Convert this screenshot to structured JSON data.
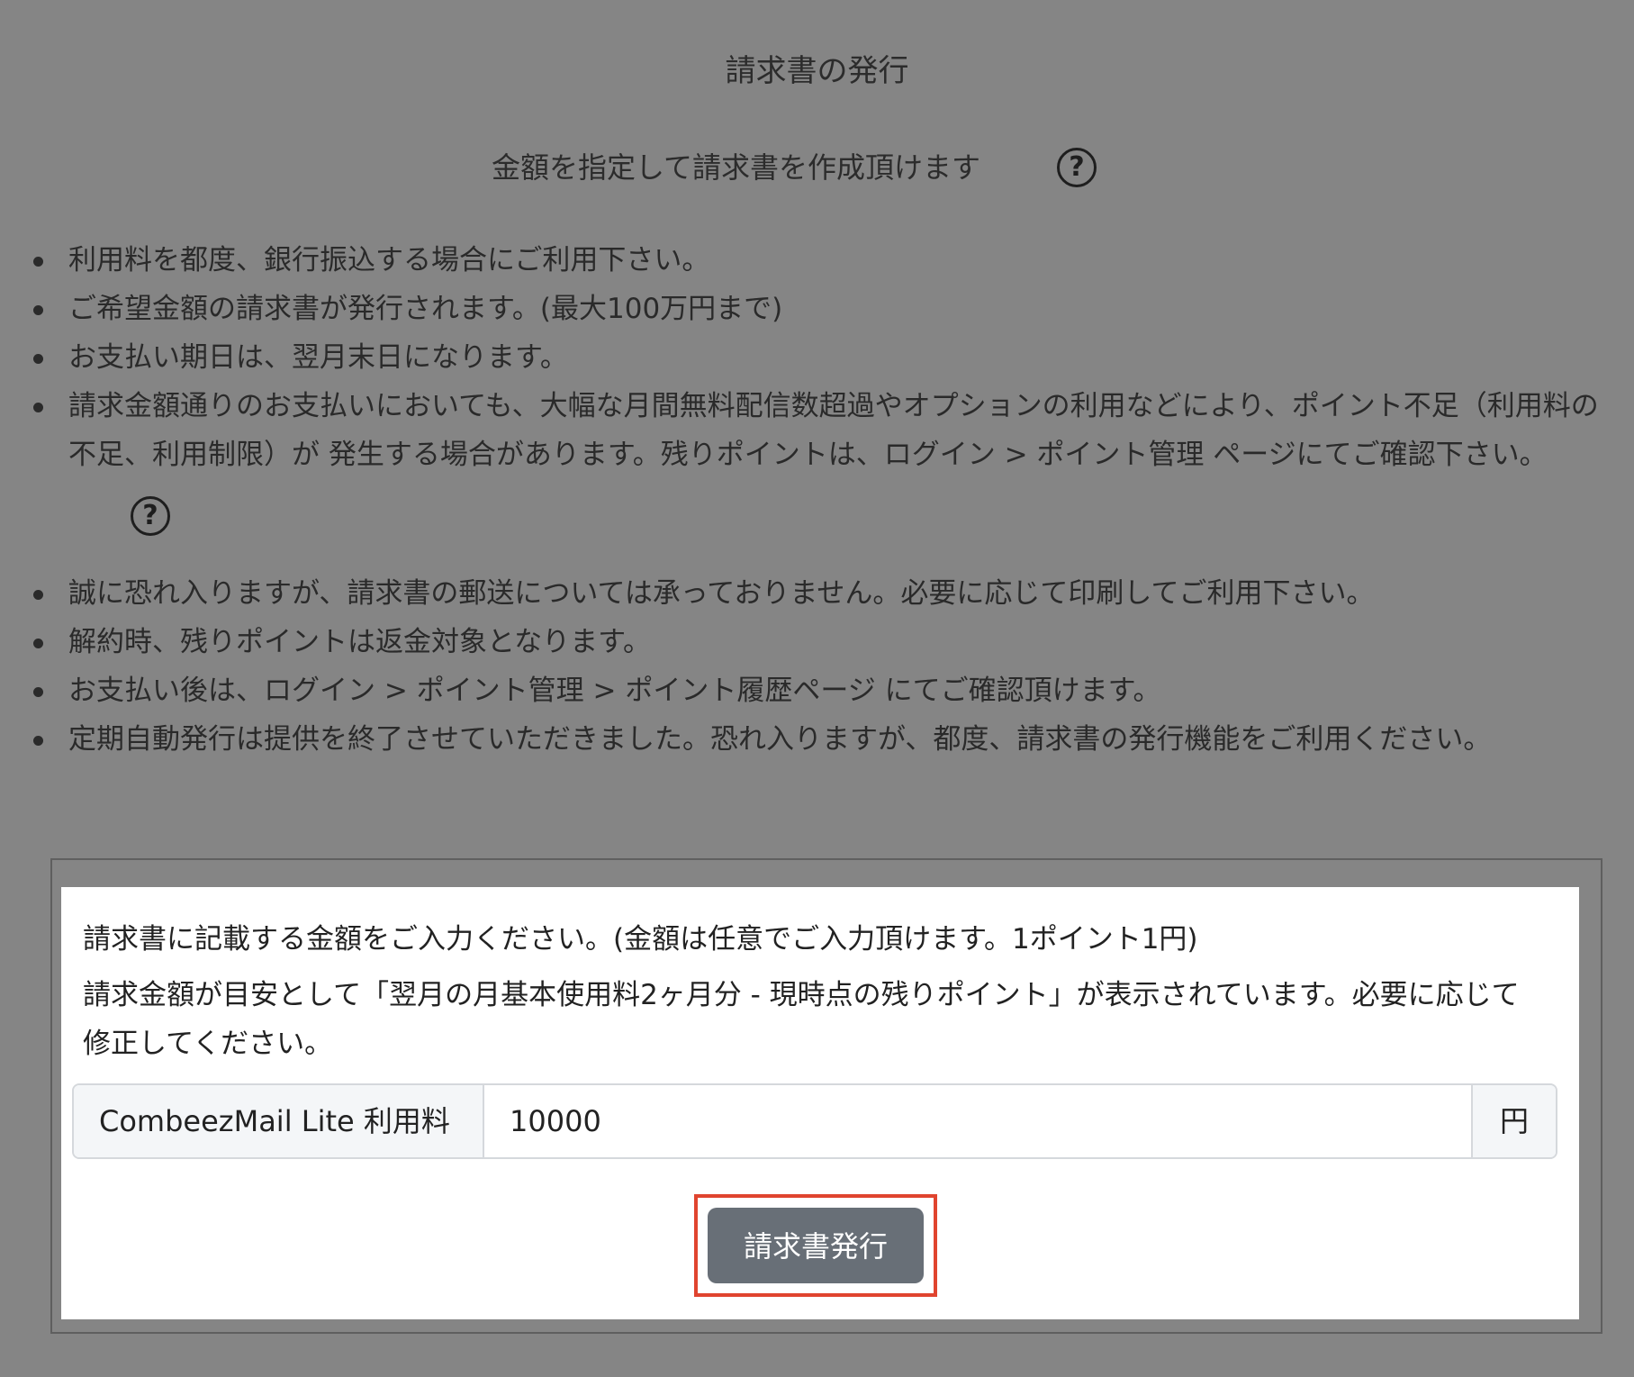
{
  "page": {
    "title": "請求書の発行",
    "subtitle": "金額を指定して請求書を作成頂けます",
    "help_icon_glyph": "?"
  },
  "notes_group_1": [
    "利用料を都度、銀行振込する場合にご利用下さい。",
    "ご希望金額の請求書が発行されます。(最大100万円まで)",
    "お支払い期日は、翌月末日になります。",
    "請求金額通りのお支払いにおいても、大幅な月間無料配信数超過やオプションの利用などにより、ポイント不足（利用料の不足、利用制限）が 発生する場合があります。残りポイントは、ログイン > ポイント管理 ページにてご確認下さい。"
  ],
  "notes_group_2": [
    "誠に恐れ入りますが、請求書の郵送については承っておりません。必要に応じて印刷してご利用下さい。",
    "解約時、残りポイントは返金対象となります。",
    "お支払い後は、ログイン > ポイント管理 > ポイント履歴ページ にてご確認頂けます。",
    "定期自動発行は提供を終了させていただきました。恐れ入りますが、都度、請求書の発行機能をご利用ください。"
  ],
  "form": {
    "instruction_1": "請求書に記載する金額をご入力ください。(金額は任意でご入力頂けます。1ポイント1円)",
    "instruction_2": "請求金額が目安として「翌月の月基本使用料2ヶ月分 - 現時点の残りポイント」が表示されています。必要に応じて修正してください。",
    "prefix_label": "CombeezMail Lite 利用料",
    "amount_value": "10000",
    "suffix_label": "円",
    "submit_label": "請求書発行"
  },
  "colors": {
    "overlay_background": "#858585",
    "card_background": "#ffffff",
    "button_background": "#686f77",
    "highlight_border": "#e0442f"
  }
}
